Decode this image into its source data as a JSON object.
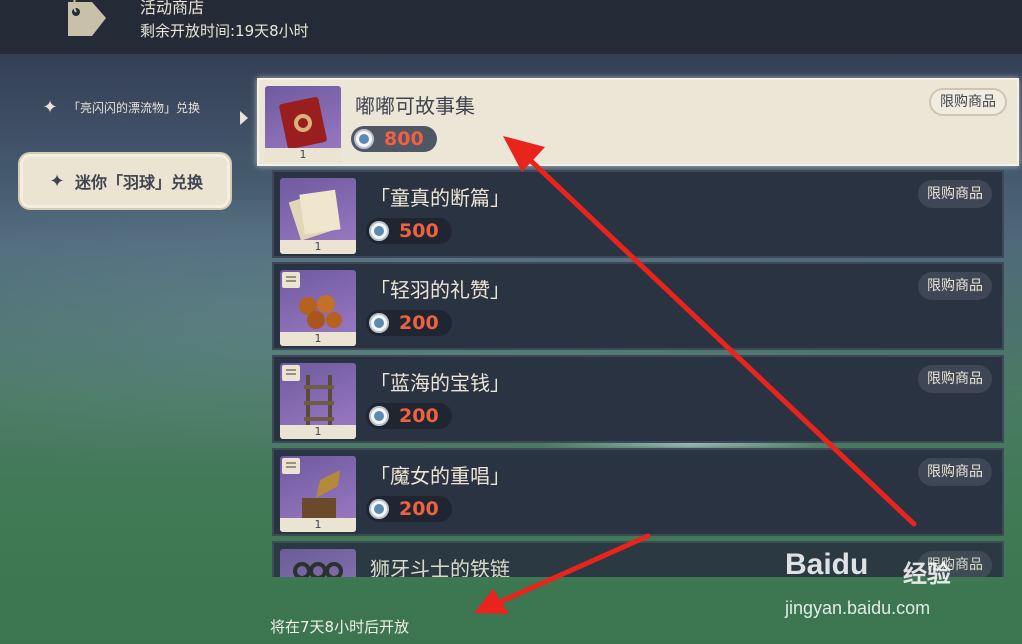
{
  "header": {
    "title": "活动商店",
    "remaining": "剩余开放时间:19天8小时"
  },
  "sidebar": {
    "items": [
      {
        "label": "「亮闪闪的漂流物」兑换"
      },
      {
        "label": "迷你「羽球」兑换"
      }
    ]
  },
  "shop": {
    "items": [
      {
        "name": "嘟嘟可故事集",
        "price": "800",
        "qty": "1",
        "badge": "限购商品"
      },
      {
        "name": "「童真的断篇」",
        "price": "500",
        "qty": "1",
        "badge": "限购商品"
      },
      {
        "name": "「轻羽的礼赞」",
        "price": "200",
        "qty": "1",
        "badge": "限购商品"
      },
      {
        "name": "「蓝海的宝钱」",
        "price": "200",
        "qty": "1",
        "badge": "限购商品"
      },
      {
        "name": "「魔女的重唱」",
        "price": "200",
        "qty": "1",
        "badge": "限购商品"
      },
      {
        "name": "狮牙斗士的铁链",
        "badge": "限购商品"
      }
    ]
  },
  "footer": {
    "note": "将在7天8小时后开放"
  },
  "watermark": {
    "logo": "Baidu",
    "logo_cn": "经验",
    "url": "jingyan.baidu.com"
  },
  "colors": {
    "price": "#ef6140",
    "arrow": "#e8241c",
    "selected_bg": "#ece6d6",
    "item_bg": "#2a3342"
  }
}
